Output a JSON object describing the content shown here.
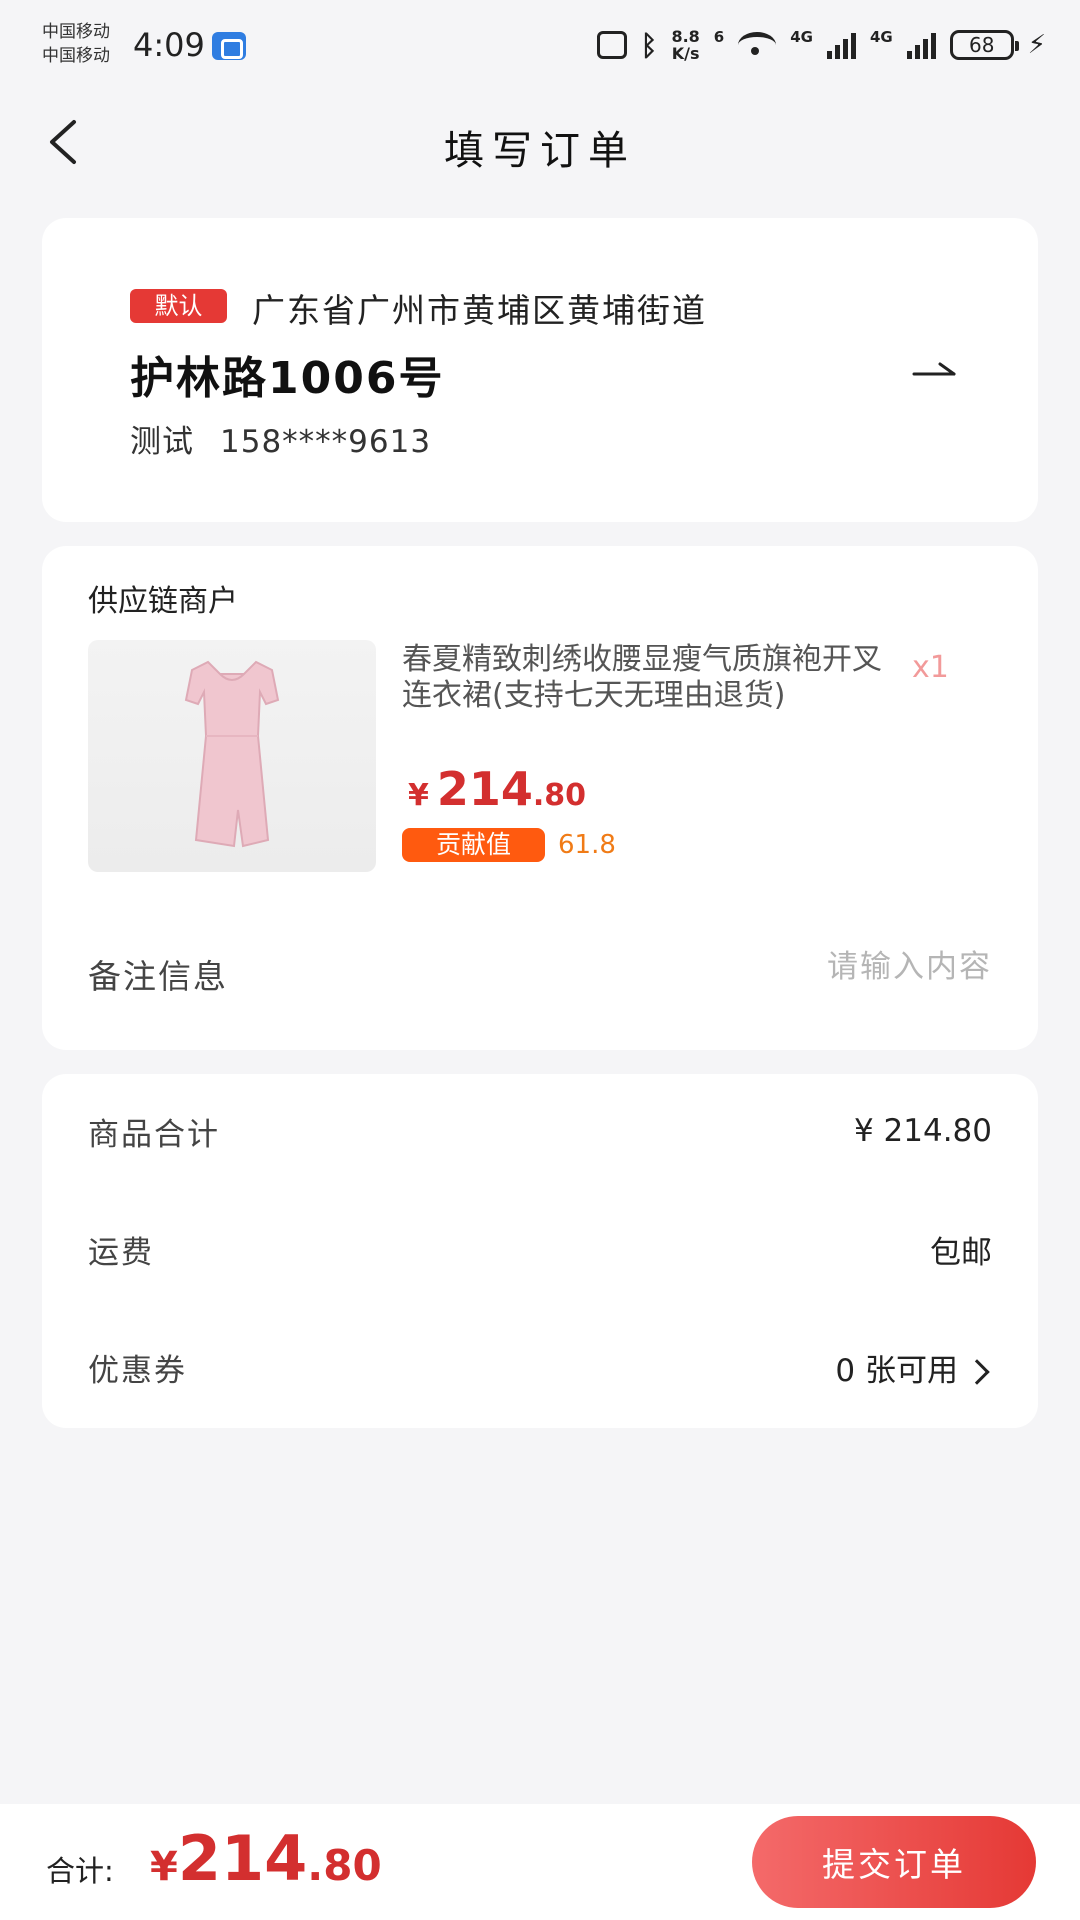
{
  "status_bar": {
    "carrier_1": "中国移动",
    "carrier_2": "中国移动",
    "time": "4:09",
    "speed_value": "8.8",
    "speed_unit": "K/s",
    "wifi_label": "6",
    "network_1": "4G",
    "network_2": "4G",
    "battery": "68"
  },
  "header": {
    "title": "填写订单"
  },
  "address": {
    "default_badge": "默认",
    "region": "广东省广州市黄埔区黄埔街道",
    "street": "护林路1006号",
    "name": "测试",
    "phone": "158****9613"
  },
  "order": {
    "merchant": "供应链商户",
    "product": {
      "title": "春夏精致刺绣收腰显瘦气质旗袍开叉连衣裙(支持七天无理由退货)",
      "quantity": "x1",
      "price_currency": "¥",
      "price_integer": "214",
      "price_decimal": ".80",
      "contribution_label": "贡献值",
      "contribution_value": "61.8"
    },
    "remark_label": "备注信息",
    "remark_placeholder": "请输入内容"
  },
  "summary": {
    "goods_total_label": "商品合计",
    "goods_total_value": "¥ 214.80",
    "shipping_label": "运费",
    "shipping_value": "包邮",
    "coupon_label": "优惠券",
    "coupon_value": "0 张可用"
  },
  "footer": {
    "total_label": "合计:",
    "total_currency": "¥",
    "total_integer": "214",
    "total_decimal": ".80",
    "submit_label": "提交订单"
  },
  "colors": {
    "brand_red": "#e53935",
    "price_red": "#d32f2f",
    "contribution_orange": "#ff5a0f",
    "background": "#f5f5f7"
  }
}
